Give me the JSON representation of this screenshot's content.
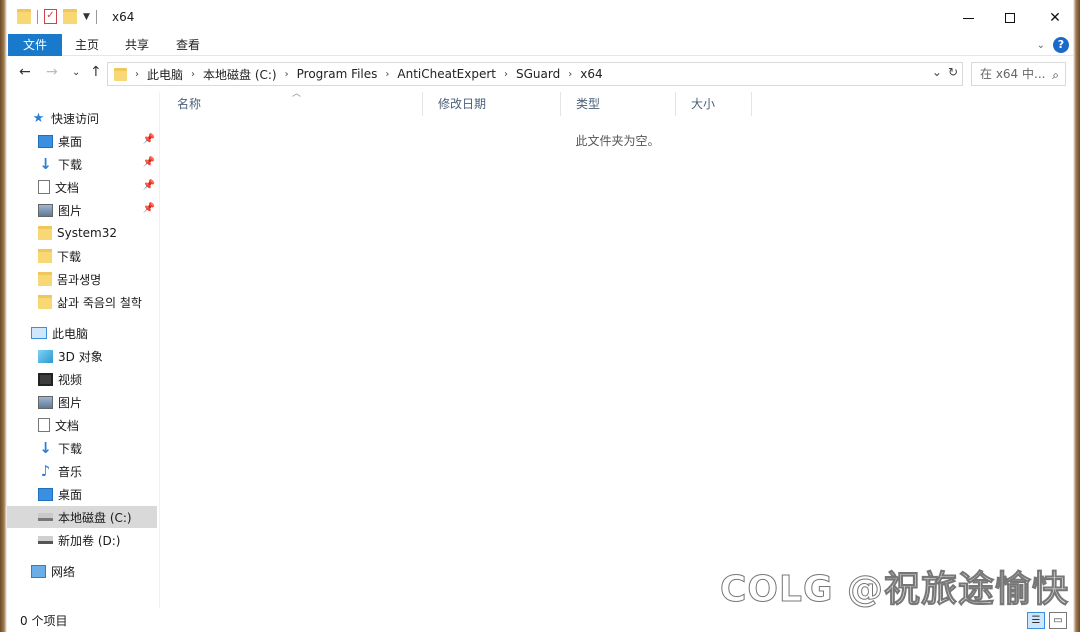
{
  "window": {
    "title": "x64"
  },
  "ribbon": {
    "tabs": [
      "文件",
      "主页",
      "共享",
      "查看"
    ],
    "help": "?"
  },
  "address": {
    "crumbs": [
      "此电脑",
      "本地磁盘 (C:)",
      "Program Files",
      "AntiCheatExpert",
      "SGuard",
      "x64"
    ]
  },
  "search": {
    "placeholder": "在 x64 中..."
  },
  "nav": {
    "quick_access": "快速访问",
    "quick_items": [
      "桌面",
      "下载",
      "文档",
      "图片",
      "System32",
      "下载",
      "몸과생명",
      "삶과 죽음의 철학"
    ],
    "this_pc": "此电脑",
    "pc_items": [
      "3D 对象",
      "视频",
      "图片",
      "文档",
      "下载",
      "音乐",
      "桌面",
      "本地磁盘 (C:)",
      "新加卷 (D:)"
    ],
    "network": "网络"
  },
  "columns": {
    "name": "名称",
    "modified": "修改日期",
    "type": "类型",
    "size": "大小"
  },
  "content": {
    "empty_message": "此文件夹为空。"
  },
  "status": {
    "item_count": "0 个项目"
  },
  "watermark": "COLG @祝旅途愉快"
}
